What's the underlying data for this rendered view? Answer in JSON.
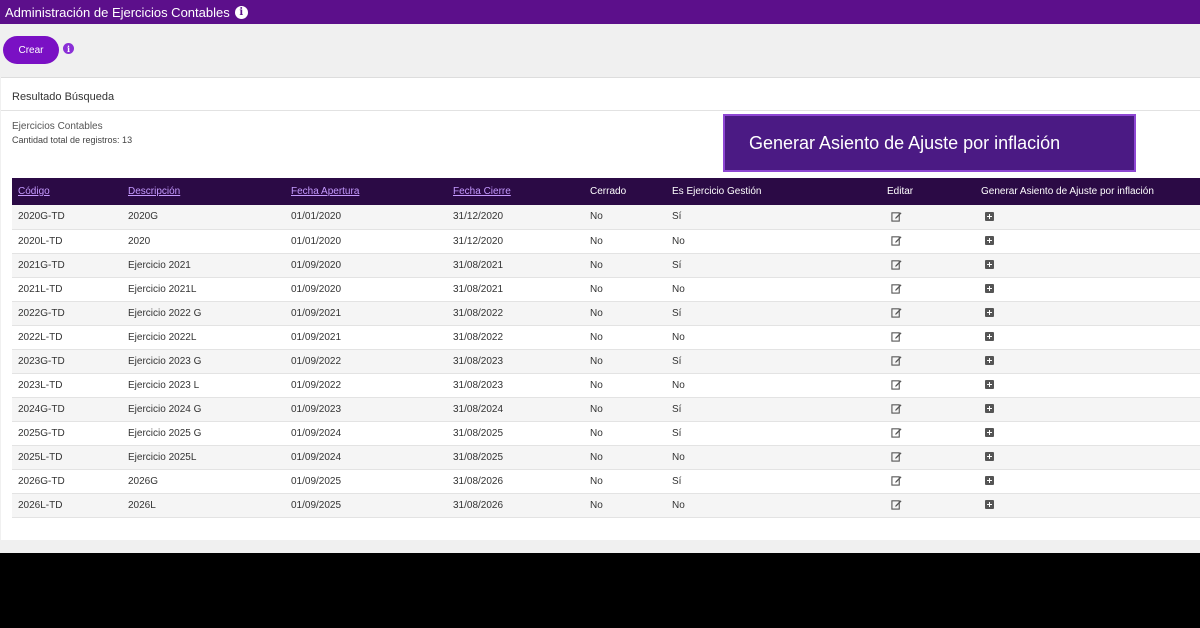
{
  "topbar": {
    "title": "Administración de Ejercicios Contables",
    "info_icon": "info-icon"
  },
  "actions": {
    "create_label": "Crear",
    "info_icon": "info-icon"
  },
  "panel": {
    "header": "Resultado Búsqueda",
    "subtitle": "Ejercicios Contables",
    "count_text": "Cantidad total de registros: 13"
  },
  "callout": {
    "label": "Generar Asiento de Ajuste por inflación"
  },
  "table": {
    "columns": [
      "Código",
      "Descripción",
      "Fecha Apertura",
      "Fecha Cierre",
      "Cerrado",
      "Es Ejercicio Gestión",
      "Editar",
      "Generar Asiento de Ajuste por inflación"
    ],
    "rows": [
      {
        "codigo": "2020G-TD",
        "descripcion": "2020G",
        "apertura": "01/01/2020",
        "cierre": "31/12/2020",
        "cerrado": "No",
        "gestion": "Sí"
      },
      {
        "codigo": "2020L-TD",
        "descripcion": "2020",
        "apertura": "01/01/2020",
        "cierre": "31/12/2020",
        "cerrado": "No",
        "gestion": "No"
      },
      {
        "codigo": "2021G-TD",
        "descripcion": "Ejercicio 2021",
        "apertura": "01/09/2020",
        "cierre": "31/08/2021",
        "cerrado": "No",
        "gestion": "Sí"
      },
      {
        "codigo": "2021L-TD",
        "descripcion": "Ejercicio 2021L",
        "apertura": "01/09/2020",
        "cierre": "31/08/2021",
        "cerrado": "No",
        "gestion": "No"
      },
      {
        "codigo": "2022G-TD",
        "descripcion": "Ejercicio 2022 G",
        "apertura": "01/09/2021",
        "cierre": "31/08/2022",
        "cerrado": "No",
        "gestion": "Sí"
      },
      {
        "codigo": "2022L-TD",
        "descripcion": "Ejercicio 2022L",
        "apertura": "01/09/2021",
        "cierre": "31/08/2022",
        "cerrado": "No",
        "gestion": "No"
      },
      {
        "codigo": "2023G-TD",
        "descripcion": "Ejercicio 2023 G",
        "apertura": "01/09/2022",
        "cierre": "31/08/2023",
        "cerrado": "No",
        "gestion": "Sí"
      },
      {
        "codigo": "2023L-TD",
        "descripcion": "Ejercicio 2023 L",
        "apertura": "01/09/2022",
        "cierre": "31/08/2023",
        "cerrado": "No",
        "gestion": "No"
      },
      {
        "codigo": "2024G-TD",
        "descripcion": "Ejercicio 2024 G",
        "apertura": "01/09/2023",
        "cierre": "31/08/2024",
        "cerrado": "No",
        "gestion": "Sí"
      },
      {
        "codigo": "2025G-TD",
        "descripcion": "Ejercicio 2025 G",
        "apertura": "01/09/2024",
        "cierre": "31/08/2025",
        "cerrado": "No",
        "gestion": "Sí"
      },
      {
        "codigo": "2025L-TD",
        "descripcion": "Ejercicio 2025L",
        "apertura": "01/09/2024",
        "cierre": "31/08/2025",
        "cerrado": "No",
        "gestion": "No"
      },
      {
        "codigo": "2026G-TD",
        "descripcion": "2026G",
        "apertura": "01/09/2025",
        "cierre": "31/08/2026",
        "cerrado": "No",
        "gestion": "Sí"
      },
      {
        "codigo": "2026L-TD",
        "descripcion": "2026L",
        "apertura": "01/09/2025",
        "cierre": "31/08/2026",
        "cerrado": "No",
        "gestion": "No"
      }
    ]
  },
  "colors": {
    "topbar": "#5c0f8b",
    "button": "#7a10c4",
    "table_header": "#2b0a45",
    "header_link": "#c59aff",
    "callout": "#4b1a84"
  }
}
